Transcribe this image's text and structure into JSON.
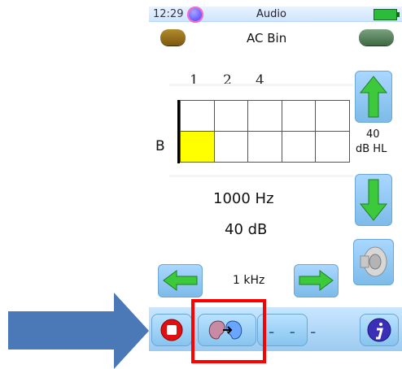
{
  "status": {
    "time": "12:29",
    "title": "Audio"
  },
  "mode": {
    "title": "AC Bin"
  },
  "grid": {
    "column_labels": [
      "1",
      "2",
      "4"
    ],
    "row_label": "B",
    "active_cell": "row1-col1"
  },
  "readout": {
    "frequency": "1000 Hz",
    "level": "40 dB"
  },
  "right_panel": {
    "db_value": "40",
    "db_unit": "dB HL"
  },
  "frequency_step": {
    "label": "1 kHz"
  },
  "toolbar": {
    "more_label": "- - -"
  },
  "icons": {
    "up": "arrow-up-icon",
    "down": "arrow-down-icon",
    "left": "arrow-left-icon",
    "right": "arrow-right-icon",
    "speaker": "speaker-icon",
    "stop": "stop-icon",
    "ear": "ear-icon",
    "info": "info-icon",
    "battery": "battery-icon",
    "status": "status-icon"
  },
  "colors": {
    "accent_blue": "#87c4ee",
    "active_cell": "#ffff00",
    "highlight_red": "#ff0000",
    "arrow_annotation": "#4b78b7",
    "green": "#3cc93c"
  }
}
